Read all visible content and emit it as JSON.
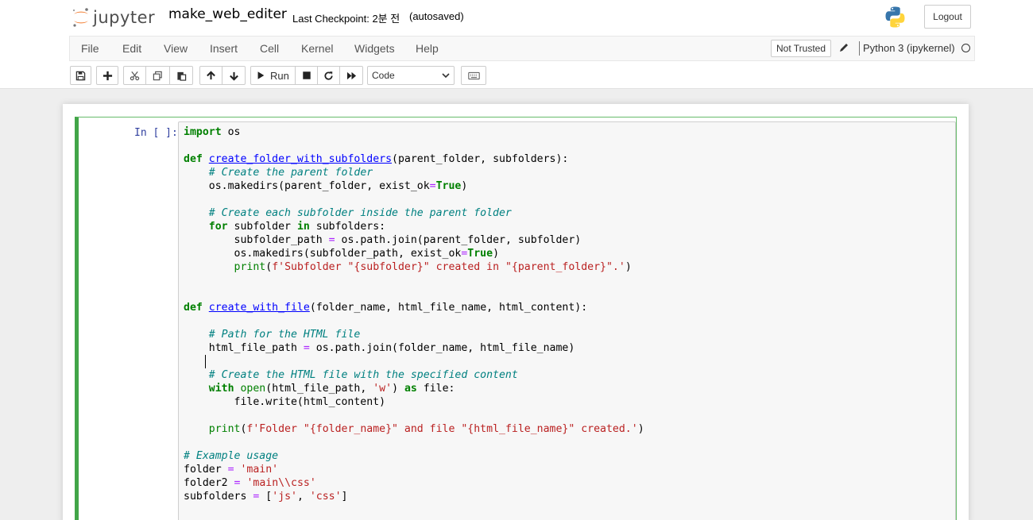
{
  "header": {
    "logo_text": "jupyter",
    "notebook_name": "make_web_editer",
    "checkpoint": "Last Checkpoint: 2분 전",
    "autosave_status": "(autosaved)",
    "logout_label": "Logout"
  },
  "menubar": {
    "items": [
      "File",
      "Edit",
      "View",
      "Insert",
      "Cell",
      "Kernel",
      "Widgets",
      "Help"
    ],
    "trust_label": "Not Trusted",
    "kernel_name": "Python 3 (ipykernel)"
  },
  "toolbar": {
    "run_label": "Run",
    "cell_type": "Code",
    "icons": [
      "save-icon",
      "plus-icon",
      "cut-icon",
      "copy-icon",
      "paste-icon",
      "arrow-up-icon",
      "arrow-down-icon",
      "run-icon",
      "stop-icon",
      "restart-icon",
      "fast-forward-icon",
      "keyboard-icon"
    ]
  },
  "cell": {
    "prompt": "In [ ]:",
    "code_lines": [
      "import os",
      "",
      "def create_folder_with_subfolders(parent_folder, subfolders):",
      "    # Create the parent folder",
      "    os.makedirs(parent_folder, exist_ok=True)",
      "",
      "    # Create each subfolder inside the parent folder",
      "    for subfolder in subfolders:",
      "        subfolder_path = os.path.join(parent_folder, subfolder)",
      "        os.makedirs(subfolder_path, exist_ok=True)",
      "        print(f'Subfolder \"{subfolder}\" created in \"{parent_folder}\".')",
      "",
      "",
      "def create_with_file(folder_name, html_file_name, html_content):",
      "",
      "    # Path for the HTML file",
      "    html_file_path = os.path.join(folder_name, html_file_name)",
      "    ",
      "    # Create the HTML file with the specified content",
      "    with open(html_file_path, 'w') as file:",
      "        file.write(html_content)",
      "",
      "    print(f'Folder \"{folder_name}\" and file \"{html_file_name}\" created.')",
      "",
      "# Example usage",
      "folder = 'main'",
      "folder2 = 'main\\\\css'",
      "subfolders = ['js', 'css']"
    ]
  }
}
